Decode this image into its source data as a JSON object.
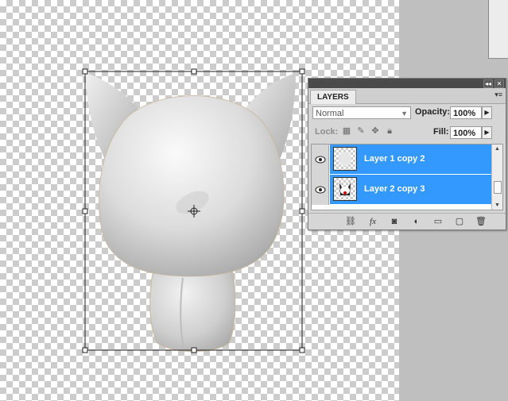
{
  "panel": {
    "tab_label": "LAYERS",
    "collapse_icon": "double-left-arrow",
    "close_icon": "close-x",
    "menu_icon": "panel-menu"
  },
  "blend_mode": {
    "value": "Normal"
  },
  "opacity": {
    "label": "Opacity:",
    "value": "100%"
  },
  "fill": {
    "label": "Fill:",
    "value": "100%"
  },
  "lock": {
    "label": "Lock:",
    "icons": [
      "lock-transparent-icon",
      "lock-image-icon",
      "lock-position-icon",
      "lock-all-icon"
    ]
  },
  "layers": [
    {
      "name": "Layer 1 copy 2",
      "visible": true,
      "selected": true
    },
    {
      "name": "Layer 2 copy 3",
      "visible": true,
      "selected": true
    }
  ],
  "bottom_icons": [
    "link-icon",
    "fx-icon",
    "mask-icon",
    "adjustment-icon",
    "group-icon",
    "new-layer-icon",
    "trash-icon"
  ],
  "colors": {
    "selection": "#3399ff",
    "panel_bg": "#d6d6d6",
    "titlebar": "#4b4b4b"
  }
}
